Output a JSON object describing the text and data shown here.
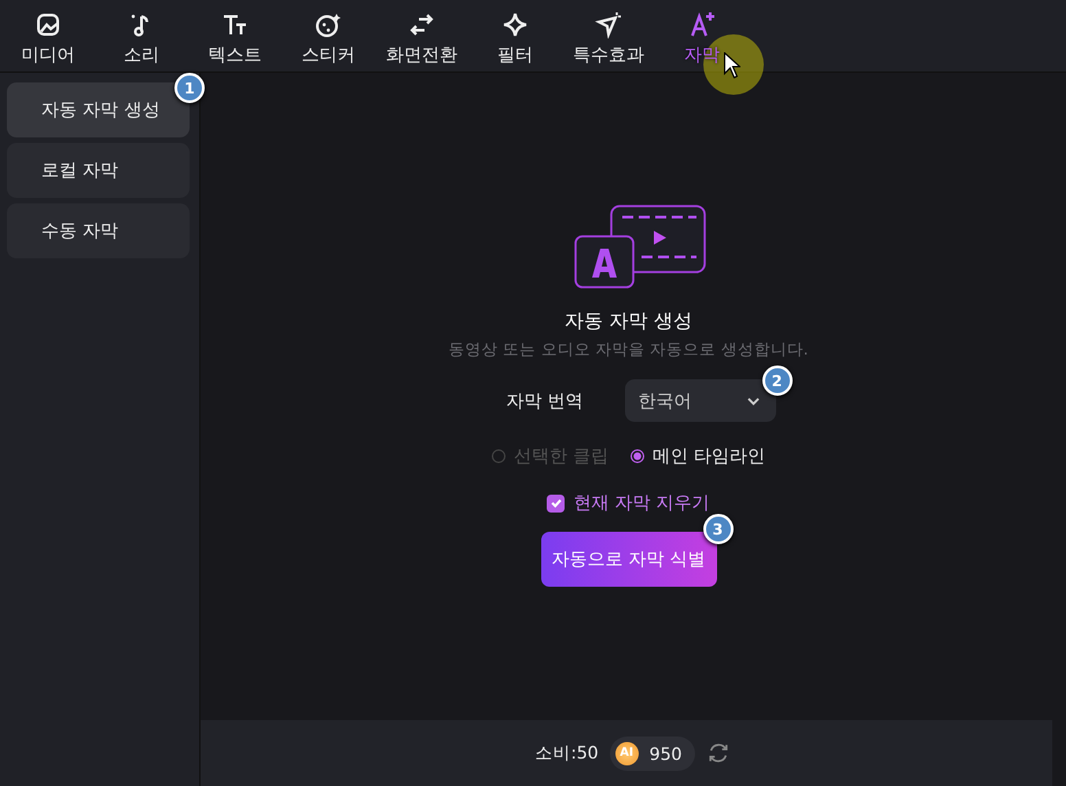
{
  "tabs": [
    {
      "label": "미디어",
      "kind": "media",
      "selected": false
    },
    {
      "label": "소리",
      "kind": "music",
      "selected": false
    },
    {
      "label": "텍스트",
      "kind": "text",
      "selected": false
    },
    {
      "label": "스티커",
      "kind": "sticker",
      "selected": false
    },
    {
      "label": "화면전환",
      "kind": "transition",
      "selected": false
    },
    {
      "label": "필터",
      "kind": "filter",
      "selected": false
    },
    {
      "label": "특수효과",
      "kind": "effect",
      "selected": false
    },
    {
      "label": "자막",
      "kind": "subtitle",
      "selected": true
    }
  ],
  "sidebar": {
    "items": [
      {
        "label": "자동 자막 생성",
        "selected": true,
        "badge": "1"
      },
      {
        "label": "로컬 자막",
        "selected": false
      },
      {
        "label": "수동 자막",
        "selected": false
      }
    ]
  },
  "panel": {
    "title": "자동 자막 생성",
    "description": "동영상 또는 오디오 자막을 자동으로 생성합니다.",
    "translate": {
      "label": "자막 번역",
      "value": "한국어",
      "badge": "2"
    },
    "scope": [
      {
        "label": "선택한 클립",
        "selected": false,
        "disabled": true
      },
      {
        "label": "메인 타임라인",
        "selected": true,
        "disabled": false
      }
    ],
    "clear_existing": {
      "label": "현재 자막 지우기",
      "checked": true
    },
    "action": {
      "label": "자동으로 자막 식별",
      "badge": "3"
    }
  },
  "footer": {
    "cost": "소비:50",
    "coin_label": "AI",
    "credits": "950"
  }
}
